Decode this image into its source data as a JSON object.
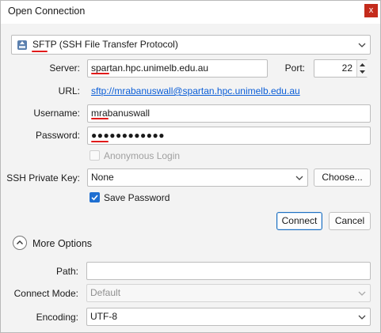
{
  "window": {
    "title": "Open Connection",
    "close_glyph": "x"
  },
  "protocol": {
    "short": "SFTP",
    "long": " (SSH File Transfer Protocol)",
    "icon": "sftp-protocol-icon"
  },
  "server": {
    "label": "Server:",
    "value": "spartan.hpc.unimelb.edu.au"
  },
  "port": {
    "label": "Port:",
    "value": "22"
  },
  "url": {
    "label": "URL:",
    "value": "sftp://mrabanuswall@spartan.hpc.unimelb.edu.au"
  },
  "username": {
    "label": "Username:",
    "value": "mrabanuswall"
  },
  "password": {
    "label": "Password:",
    "value": "●●●●●●●●●●●●"
  },
  "anonymous": {
    "label": "Anonymous Login",
    "checked": false
  },
  "ssh_key": {
    "label": "SSH Private Key:",
    "value": "None",
    "choose_label": "Choose..."
  },
  "save_password": {
    "label": "Save Password",
    "checked": true
  },
  "actions": {
    "connect_label": "Connect",
    "cancel_label": "Cancel"
  },
  "more_options": {
    "label": "More Options"
  },
  "path": {
    "label": "Path:",
    "value": ""
  },
  "connect_mode": {
    "label": "Connect Mode:",
    "value": "Default"
  },
  "encoding": {
    "label": "Encoding:",
    "value": "UTF-8"
  },
  "colors": {
    "accent": "#0b5ed7",
    "annotation": "#e11a1a",
    "close": "#c42b1c",
    "check": "#1f6fd1"
  }
}
